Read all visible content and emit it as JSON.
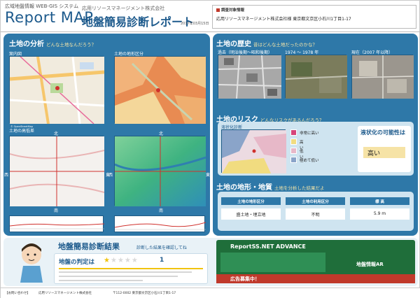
{
  "header": {
    "system_label": "広域地盤情報 WEB-GIS システム",
    "logo_title": "Report MAP",
    "company": "応用リソースマネージメント株式会社",
    "report_title": "地盤簡易診断レポート",
    "date": "2017年03月15日"
  },
  "survey": {
    "label": "調査対象情報",
    "value": "応用リソースマネージメント株式会社様 東京都文京区小石川1丁目1-17"
  },
  "left": {
    "heading": "土地の分析",
    "heading_sub": "どんな土地なんだろう？",
    "map1_title": "案内図",
    "map2_title": "土地の地形区分",
    "map3_title": "土地の高低差",
    "north": "北",
    "south": "南",
    "east": "東",
    "west": "西"
  },
  "history": {
    "heading": "土地の歴史",
    "heading_sub": "昔はどんな土地だったのかな？",
    "photo1": "過去（明治後期〜昭和後期）",
    "photo2": "1974 〜 1978 年",
    "photo3": "現在（2007 年以降）"
  },
  "risk": {
    "heading": "土地のリスク",
    "heading_sub": "どんなリスクがあるんだろう？",
    "map_title": "液状化診断",
    "legend": [
      {
        "label": "非常に高い",
        "color": "#d6457a"
      },
      {
        "label": "高い",
        "color": "#f1dc80"
      },
      {
        "label": "低い",
        "color": "#e7b8c8"
      },
      {
        "label": "極めて低い",
        "color": "#8aa4c9"
      }
    ],
    "possibility_label": "液状化の可能性は",
    "possibility_value": "高い"
  },
  "terrain": {
    "heading": "土地の地形・地質",
    "heading_sub": "土地を分析した結果だよ",
    "headers": [
      "土地の地形区分",
      "土地の利用区分",
      "標 高"
    ],
    "values": [
      "盛土地・埋立地",
      "不明",
      "5.9 m"
    ]
  },
  "result": {
    "title": "地盤簡易診断結果",
    "subtitle": "診断した結果を確認してね",
    "rating_label": "地盤の判定は",
    "rating": 1,
    "rating_max": 5,
    "rating_number": "1"
  },
  "ad": {
    "text": "ReportSS.NET ADVANCE",
    "text2": "地盤情報AR",
    "bar": "広告募集中！"
  },
  "footer": {
    "contact": "【お問い合わせ】",
    "company": "応用リソースマネージメント株式会社",
    "address": "〒112-0002 東京都文京区小石川1丁目1-17"
  },
  "colors": {
    "panel": "#2e78a8",
    "accent": "#1d5a8c"
  }
}
